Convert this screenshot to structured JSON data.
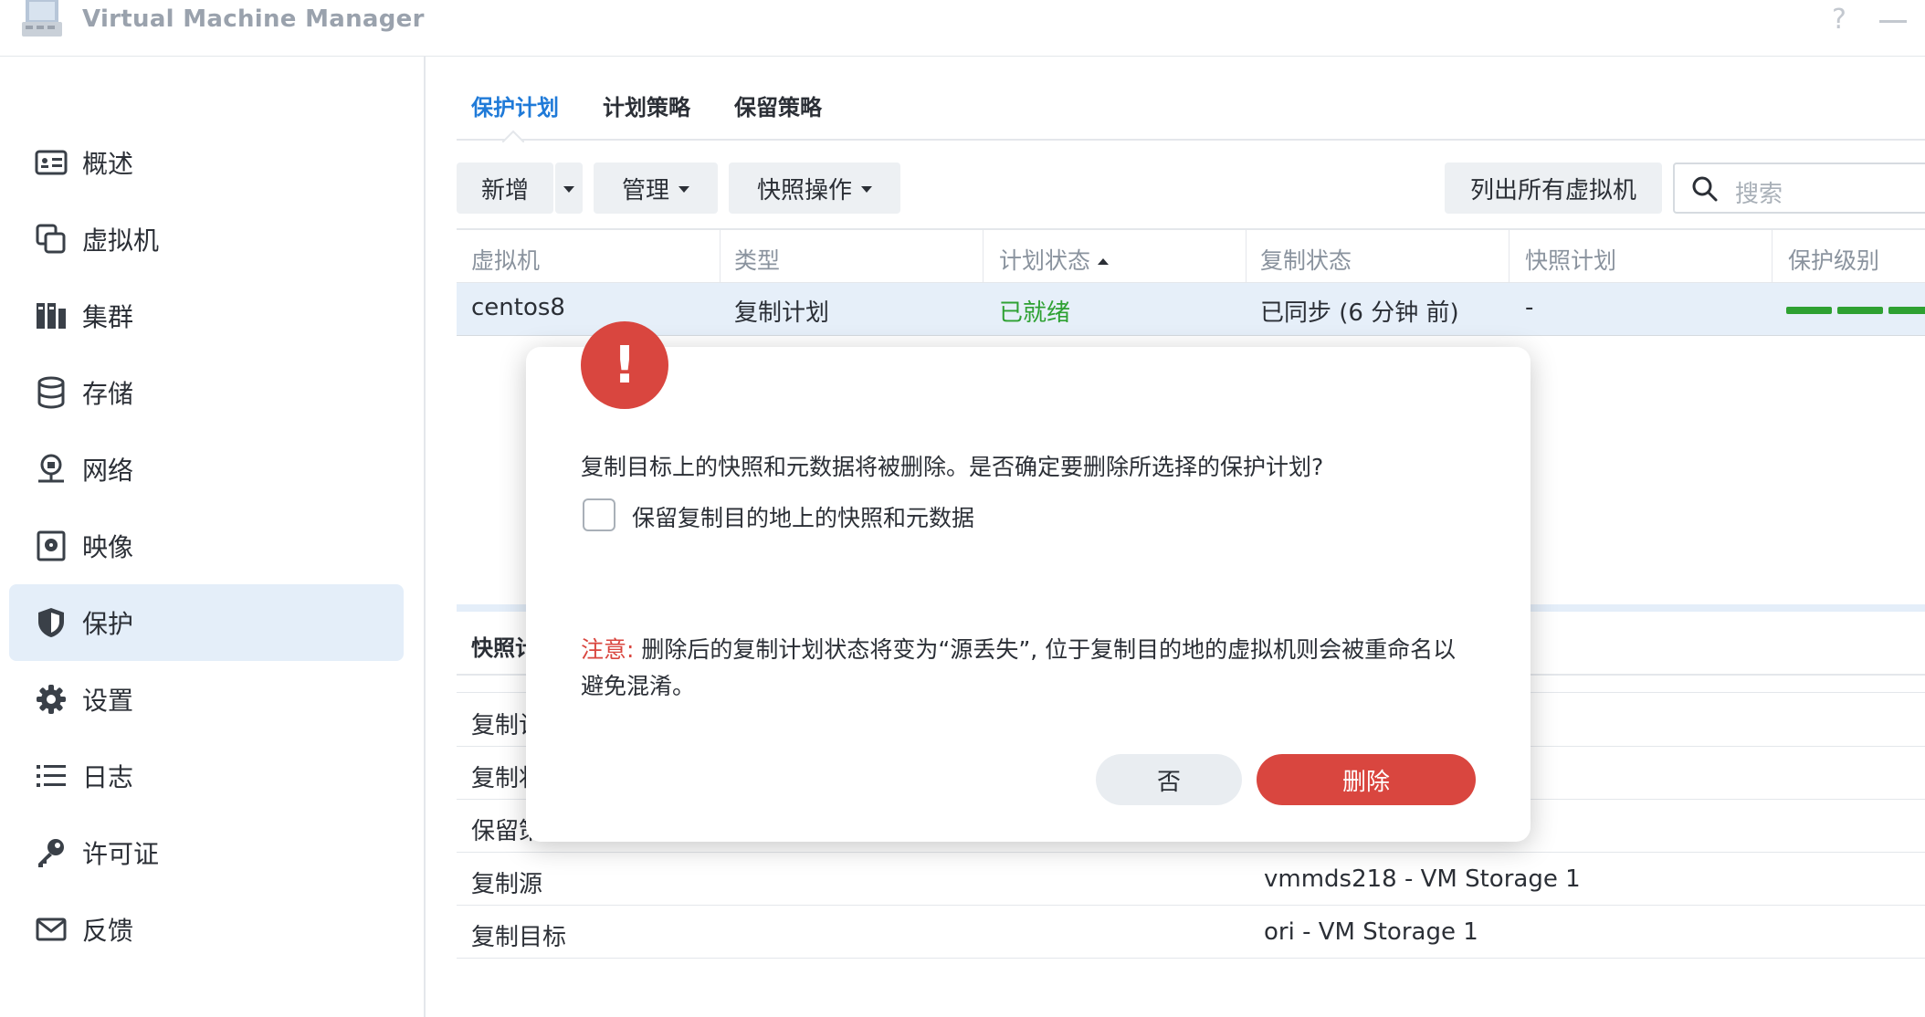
{
  "app": {
    "title": "Virtual Machine Manager",
    "help": "?"
  },
  "sidebar": {
    "items": [
      {
        "label": "概述",
        "icon": "overview-icon"
      },
      {
        "label": "虚拟机",
        "icon": "vm-icon"
      },
      {
        "label": "集群",
        "icon": "cluster-icon"
      },
      {
        "label": "存储",
        "icon": "storage-icon"
      },
      {
        "label": "网络",
        "icon": "network-icon"
      },
      {
        "label": "映像",
        "icon": "image-icon"
      },
      {
        "label": "保护",
        "icon": "shield-icon",
        "active": true
      },
      {
        "label": "设置",
        "icon": "gear-icon"
      },
      {
        "label": "日志",
        "icon": "list-icon"
      },
      {
        "label": "许可证",
        "icon": "key-icon"
      },
      {
        "label": "反馈",
        "icon": "mail-icon"
      }
    ]
  },
  "tabs": [
    {
      "label": "保护计划",
      "active": true
    },
    {
      "label": "计划策略"
    },
    {
      "label": "保留策略"
    }
  ],
  "toolbar": {
    "add": "新增",
    "manage": "管理",
    "snapshot_ops": "快照操作",
    "list_all": "列出所有虚拟机",
    "search_placeholder": "搜索"
  },
  "table": {
    "columns": [
      "虚拟机",
      "类型",
      "计划状态",
      "复制状态",
      "快照计划",
      "保护级别"
    ],
    "rows": [
      {
        "vm": "centos8",
        "type": "复制计划",
        "plan_status": "已就绪",
        "replication_status": "已同步 (6 分钟 前)",
        "snapshot_plan": "-",
        "protection_level": 3
      }
    ]
  },
  "detail": {
    "title": "快照计",
    "rows": [
      {
        "label": "复制计",
        "value": ""
      },
      {
        "label": "复制状",
        "value": ""
      },
      {
        "label": "保留策",
        "value": ""
      },
      {
        "label": "复制源",
        "value": "vmmds218 - VM Storage 1"
      },
      {
        "label": "复制目标",
        "value": "ori - VM Storage 1"
      }
    ]
  },
  "dialog": {
    "icon": "!",
    "message": "复制目标上的快照和元数据将被删除。是否确定要删除所选择的保护计划?",
    "checkbox_label": "保留复制目的地上的快照和元数据",
    "checkbox_checked": false,
    "note_prefix": "注意:",
    "note_body": " 删除后的复制计划状态将变为“源丢失”, 位于复制目的地的虚拟机则会被重命名以避免混淆。",
    "btn_no": "否",
    "btn_delete": "删除"
  },
  "colors": {
    "accent": "#1f7ad8",
    "danger": "#d9463f",
    "success": "#2ea132",
    "active_bg": "#e4eef9"
  }
}
